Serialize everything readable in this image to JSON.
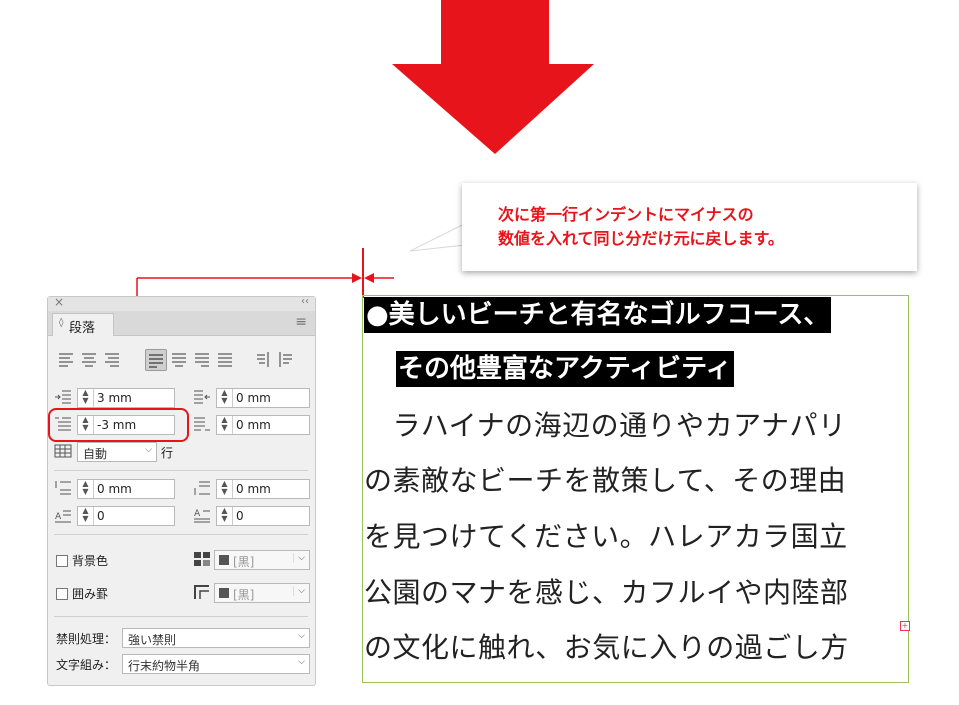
{
  "callout": {
    "line1": "次に第一行インデントにマイナスの",
    "line2": "数値を入れて同じ分だけ元に戻します。"
  },
  "panel": {
    "tab_label": "段落",
    "close_glyph": "×",
    "collapse_glyph": "‹‹",
    "menu_glyph": "≡",
    "left_indent": "3 mm",
    "right_indent": "0 mm",
    "first_line_indent": "-3 mm",
    "last_line_indent": "0 mm",
    "auto_leading": "自動",
    "lines_label": "行",
    "space_before": "0 mm",
    "space_after": "0 mm",
    "drop_cap_lines": "0",
    "drop_cap_chars": "0",
    "shading_label": "背景色",
    "shading_color": "[黒]",
    "border_label": "囲み罫",
    "border_color": "[黒]",
    "kinsoku_label": "禁則処理：",
    "kinsoku_value": "強い禁則",
    "mojikumi_label": "文字組み：",
    "mojikumi_value": "行末約物半角"
  },
  "text": {
    "heading1": "●美しいビーチと有名なゴルフコース、",
    "heading2": "その他豊富なアクティビティ",
    "lines": [
      "　ラハイナの海辺の通りやカアナパリ",
      "の素敵なビーチを散策して、その理由",
      "を見つけてください。ハレアカラ国立",
      "公園のマナを感じ、カフルイや内陸部",
      "の文化に触れ、お気に入りの過ごし方"
    ],
    "overset_glyph": "+"
  },
  "colors": {
    "accent_red": "#e8141b",
    "frame_green": "#9cc25c"
  }
}
